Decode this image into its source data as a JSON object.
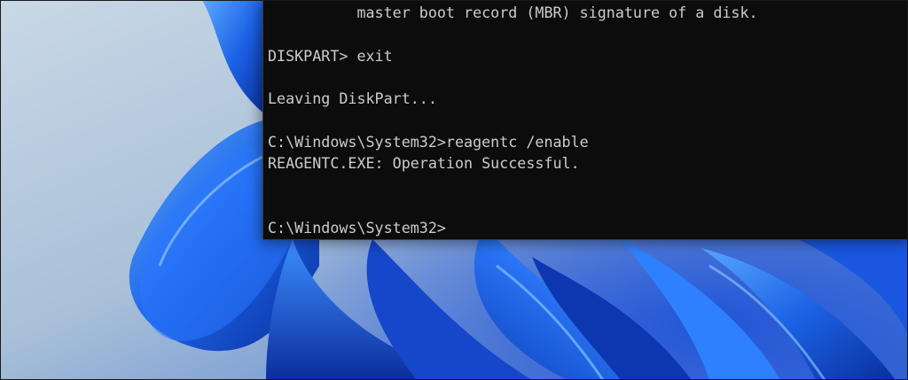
{
  "terminal": {
    "lines": [
      "          master boot record (MBR) signature of a disk.",
      "",
      "DISKPART> exit",
      "",
      "Leaving DiskPart...",
      "",
      "C:\\Windows\\System32>reagentc /enable",
      "REAGENTC.EXE: Operation Successful.",
      "",
      "",
      "C:\\Windows\\System32>"
    ],
    "text_color": "#cccccc",
    "background_color": "#0c0c0c"
  },
  "wallpaper": {
    "name": "windows-11-bloom-wallpaper",
    "primary_color": "#1f6fe8",
    "background_color": "#b9cde0"
  }
}
